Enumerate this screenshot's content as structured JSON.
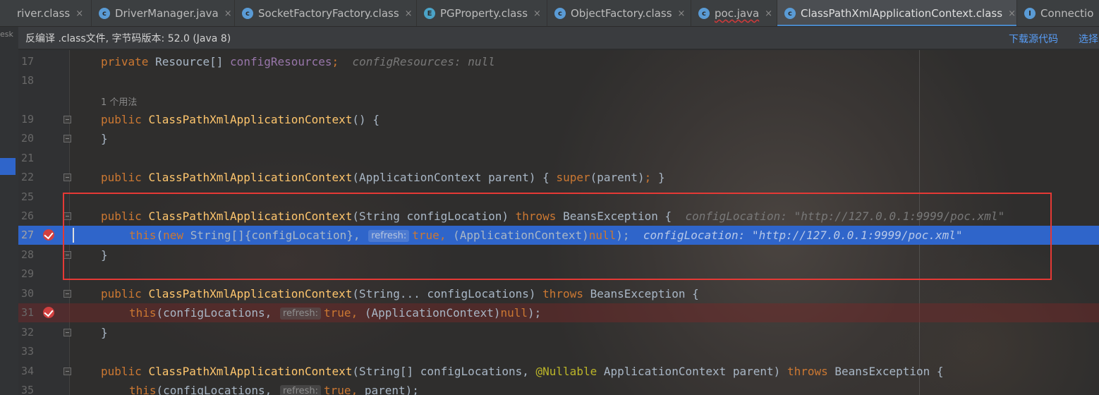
{
  "tabs": [
    {
      "label": "river.class",
      "icon": "class-icon",
      "letter": "",
      "color": "#5a9bd5"
    },
    {
      "label": "DriverManager.java",
      "icon": "class-icon",
      "letter": "c",
      "color": "#5a9bd5"
    },
    {
      "label": "SocketFactoryFactory.class",
      "icon": "class-icon",
      "letter": "c",
      "color": "#5a9bd5"
    },
    {
      "label": "PGProperty.class",
      "icon": "enum-icon",
      "letter": "E",
      "color": "#4ba3c7"
    },
    {
      "label": "ObjectFactory.class",
      "icon": "class-icon",
      "letter": "c",
      "color": "#5a9bd5"
    },
    {
      "label": "poc.java",
      "icon": "java-file-icon",
      "letter": "c",
      "color": "#5a9bd5"
    },
    {
      "label": "ClassPathXmlApplicationContext.class",
      "icon": "class-icon",
      "letter": "c",
      "color": "#5a9bd5"
    },
    {
      "label": "Connectio",
      "icon": "interface-icon",
      "letter": "I",
      "color": "#5a9bd5"
    }
  ],
  "tab_close": "×",
  "left_strip_label": "esk",
  "banner": {
    "text": "反编译 .class文件, 字节码版本: 52.0 (Java 8)",
    "download_link": "下载源代码",
    "select_link": "选择"
  },
  "usage_hint": "1 个用法",
  "lines": {
    "l17": "17",
    "l18": "18",
    "l19": "19",
    "l20": "20",
    "l21": "21",
    "l22": "22",
    "l25": "25",
    "l26": "26",
    "l27": "27",
    "l28": "28",
    "l29": "29",
    "l30": "30",
    "l31": "31",
    "l32": "32",
    "l33": "33",
    "l34": "34",
    "l35": "35"
  },
  "code": {
    "kw_private": "private",
    "kw_public": "public",
    "kw_throws": "throws",
    "kw_this": "this",
    "kw_new": "new",
    "kw_super": "super",
    "kw_true": "true,",
    "kw_null": "null",
    "t_resource": "Resource[]",
    "f_configResources": "configResources",
    "semi": ";",
    "hint17": "configResources: null",
    "m_ctor": "ClassPathXmlApplicationContext",
    "t_empty_args": "() {",
    "t_close_brace": "}",
    "t_ctx_parent": "(ApplicationContext parent)",
    "t_brace_open": "{",
    "t_super_call": "(parent)",
    "t_super_end": "; }",
    "t_string_loc": "(String configLocation)",
    "t_beansexc": "BeansException {",
    "hint26": "configLocation: \"http://127.0.0.1:9999/poc.xml\"",
    "t_paren": "(",
    "t_strarr_loc": "String[]{configLocation},",
    "refresh_chip": "refresh:",
    "t_cast": "(ApplicationContext)",
    "t_end": ");",
    "hint27": "configLocation: \"http://127.0.0.1:9999/poc.xml\"",
    "t_varargs": "(String... configLocations)",
    "t_locs": "(configLocations,",
    "t_strarr_locs": "(String[] configLocations,",
    "a_nullable": "@Nullable",
    "t_appctx_parent": "ApplicationContext parent)",
    "t_parent_end": "parent);"
  }
}
